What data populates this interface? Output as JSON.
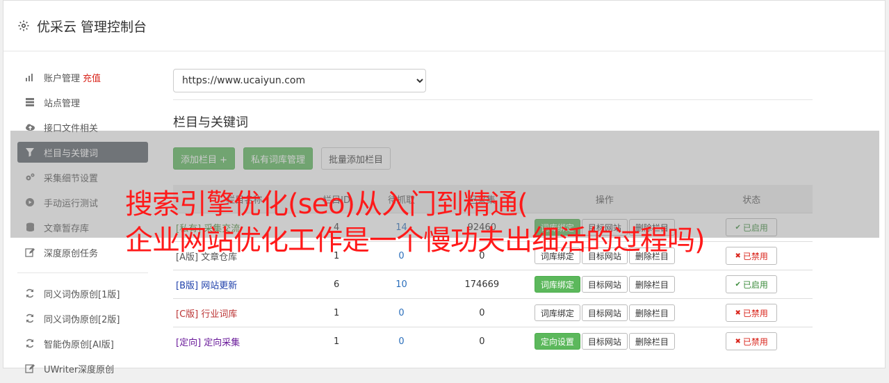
{
  "header": {
    "title": "优采云 管理控制台"
  },
  "sidebar": {
    "items": [
      {
        "label": "账户管理",
        "extra": "充值",
        "icon": "bar-chart-icon"
      },
      {
        "label": "站点管理",
        "icon": "server-icon"
      },
      {
        "label": "接口文件相关",
        "icon": "cloud-upload-icon"
      },
      {
        "label": "栏目与关键词",
        "icon": "filter-icon",
        "active": true
      },
      {
        "label": "采集细节设置",
        "icon": "cogs-icon"
      },
      {
        "label": "手动运行测试",
        "icon": "play-circle-icon"
      },
      {
        "label": "文章暂存库",
        "icon": "database-icon"
      },
      {
        "label": "深度原创任务",
        "icon": "edit-icon"
      }
    ],
    "items2": [
      {
        "label": "同义词伪原创[1版]",
        "icon": "refresh-icon"
      },
      {
        "label": "同义词伪原创[2版]",
        "icon": "refresh-icon"
      },
      {
        "label": "智能伪原创[AI版]",
        "icon": "refresh-icon"
      },
      {
        "label": "UWriter深度原创",
        "icon": "edit-icon"
      }
    ]
  },
  "main": {
    "site_select": "https://www.ucaiyun.com",
    "section_title": "栏目与关键词",
    "buttons": {
      "add": "添加栏目 +",
      "private": "私有词库管理",
      "batch": "批量添加栏目"
    },
    "table": {
      "headers": [
        "栏目名称",
        "栏目ID",
        "待抓取",
        "已采集",
        "操作",
        "状态"
      ],
      "rows": [
        {
          "tag": "[私有]",
          "name": "采集交流",
          "id": "4",
          "pending": "14",
          "collected": "92460",
          "op1": "词库绑定",
          "op1_green": true,
          "op2": "目标网站",
          "op3": "删除栏目",
          "status": "已启用",
          "on": true,
          "tagclass": "tag-private"
        },
        {
          "tag": "[A版]",
          "name": "文章仓库",
          "id": "1",
          "pending": "0",
          "collected": "0",
          "op1": "词库绑定",
          "op1_green": false,
          "op2": "目标网站",
          "op3": "删除栏目",
          "status": "已禁用",
          "on": false,
          "tagclass": "tag-a"
        },
        {
          "tag": "[B版]",
          "name": "网站更新",
          "id": "6",
          "pending": "10",
          "collected": "174669",
          "op1": "词库绑定",
          "op1_green": true,
          "op2": "目标网站",
          "op3": "删除栏目",
          "status": "已启用",
          "on": true,
          "tagclass": "tag-b"
        },
        {
          "tag": "[C版]",
          "name": "行业词库",
          "id": "1",
          "pending": "0",
          "collected": "0",
          "op1": "词库绑定",
          "op1_green": false,
          "op2": "目标网站",
          "op3": "删除栏目",
          "status": "已禁用",
          "on": false,
          "tagclass": "tag-c"
        },
        {
          "tag": "[定向]",
          "name": "定向采集",
          "id": "1",
          "pending": "0",
          "collected": "0",
          "op1": "定向设置",
          "op1_green": true,
          "op2": "目标网站",
          "op3": "删除栏目",
          "status": "已禁用",
          "on": false,
          "tagclass": "tag-dir"
        }
      ]
    }
  },
  "overlay": {
    "line1": "搜索引擎优化(seo)从入门到精通(",
    "line2": "企业网站优化工作是一个慢功夫出细活的过程吗)"
  },
  "colors": {
    "accent_green": "#5cb85c",
    "overlay_text": "#ff1a1a",
    "active_nav": "#5a6169"
  }
}
